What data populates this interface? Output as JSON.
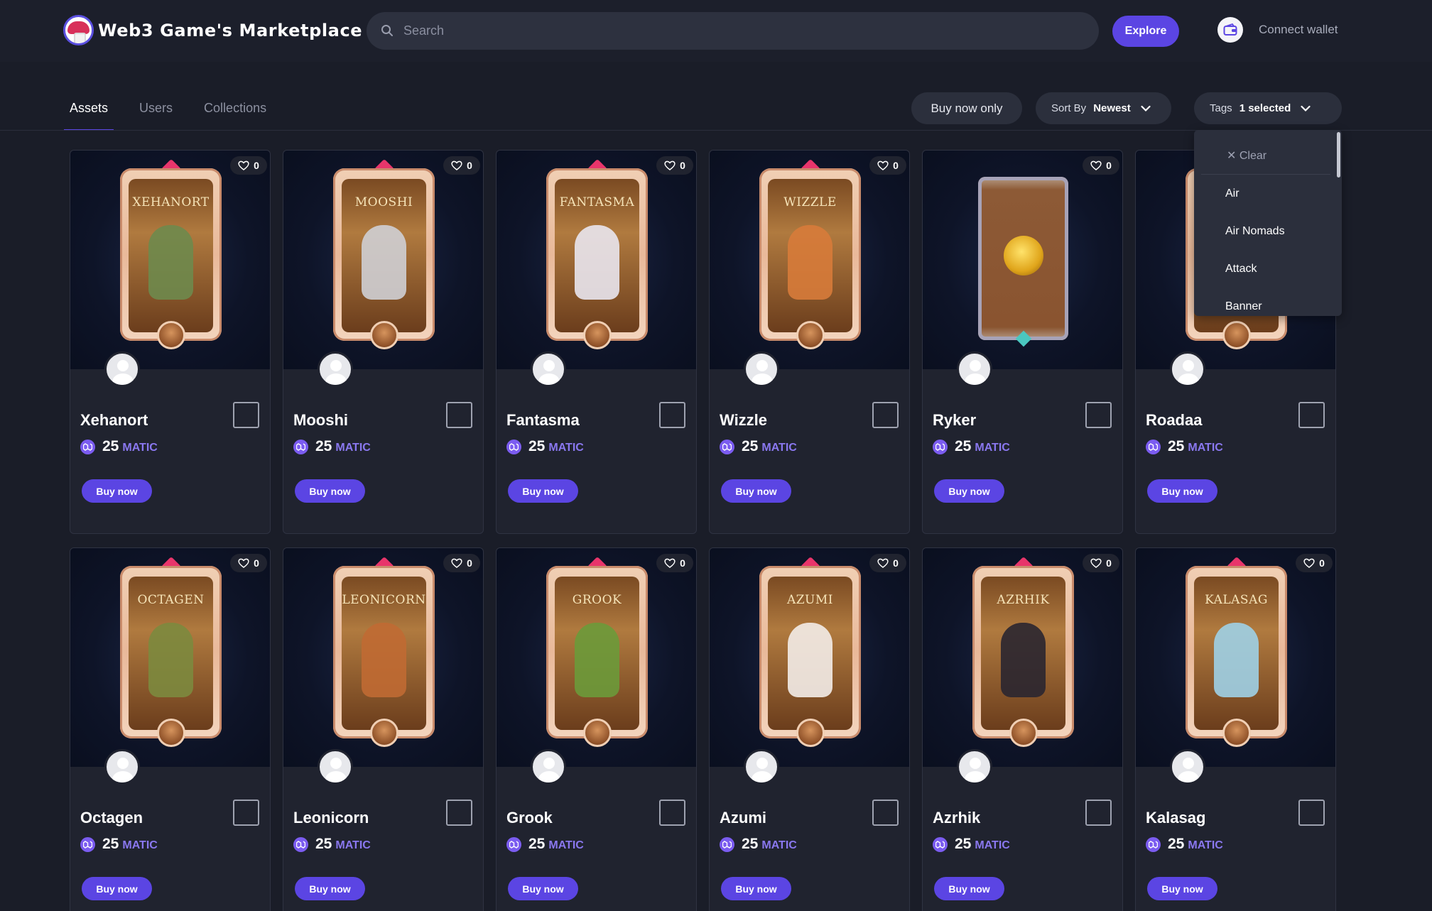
{
  "header": {
    "logo_text": "Web3 Game's Marketplace",
    "search_placeholder": "Search",
    "explore_label": "Explore",
    "connect_label": "Connect wallet"
  },
  "tabs": [
    {
      "label": "Assets",
      "active": true
    },
    {
      "label": "Users",
      "active": false
    },
    {
      "label": "Collections",
      "active": false
    }
  ],
  "filters": {
    "buy_now_only": "Buy now only",
    "sort_label": "Sort By",
    "sort_value": "Newest",
    "tags_label": "Tags",
    "tags_value": "1 selected"
  },
  "tags_dropdown": {
    "clear_label": "Clear",
    "options": [
      "Air",
      "Air Nomads",
      "Attack",
      "Banner"
    ]
  },
  "colors": {
    "accent": "#5b45e3",
    "background": "#1a1d28",
    "card": "#20232f",
    "matic": "#7b5cf0"
  },
  "cards": [
    {
      "name": "Xehanort",
      "nft_label": "XEHANORT",
      "likes": "0",
      "price": "25",
      "currency": "MATIC",
      "buy_label": "Buy now",
      "figure_color": "#6e8a4c"
    },
    {
      "name": "Mooshi",
      "nft_label": "MOOSHI",
      "likes": "0",
      "price": "25",
      "currency": "MATIC",
      "buy_label": "Buy now",
      "figure_color": "#cfcfd4"
    },
    {
      "name": "Fantasma",
      "nft_label": "FANTASMA",
      "likes": "0",
      "price": "25",
      "currency": "MATIC",
      "buy_label": "Buy now",
      "figure_color": "#e9e6ee"
    },
    {
      "name": "Wizzle",
      "nft_label": "WIZZLE",
      "likes": "0",
      "price": "25",
      "currency": "MATIC",
      "buy_label": "Buy now",
      "figure_color": "#d77b3a"
    },
    {
      "name": "Ryker",
      "nft_label": "",
      "likes": "0",
      "price": "25",
      "currency": "MATIC",
      "buy_label": "Buy now",
      "figure_color": "#e0a51b"
    },
    {
      "name": "Roadaa",
      "nft_label": "",
      "likes": "0",
      "price": "25",
      "currency": "MATIC",
      "buy_label": "Buy now",
      "figure_color": "#b07a3f"
    },
    {
      "name": "Octagen",
      "nft_label": "OCTAGEN",
      "likes": "0",
      "price": "25",
      "currency": "MATIC",
      "buy_label": "Buy now",
      "figure_color": "#7c8a3e"
    },
    {
      "name": "Leonicorn",
      "nft_label": "LEONICORN",
      "likes": "0",
      "price": "25",
      "currency": "MATIC",
      "buy_label": "Buy now",
      "figure_color": "#c06a33"
    },
    {
      "name": "Grook",
      "nft_label": "GROOK",
      "likes": "0",
      "price": "25",
      "currency": "MATIC",
      "buy_label": "Buy now",
      "figure_color": "#6c9a3a"
    },
    {
      "name": "Azumi",
      "nft_label": "AZUMI",
      "likes": "0",
      "price": "25",
      "currency": "MATIC",
      "buy_label": "Buy now",
      "figure_color": "#f3ece8"
    },
    {
      "name": "Azrhik",
      "nft_label": "AZRHIK",
      "likes": "0",
      "price": "25",
      "currency": "MATIC",
      "buy_label": "Buy now",
      "figure_color": "#2a2630"
    },
    {
      "name": "Kalasag",
      "nft_label": "KALASAG",
      "likes": "0",
      "price": "25",
      "currency": "MATIC",
      "buy_label": "Buy now",
      "figure_color": "#9fd0e6"
    }
  ]
}
